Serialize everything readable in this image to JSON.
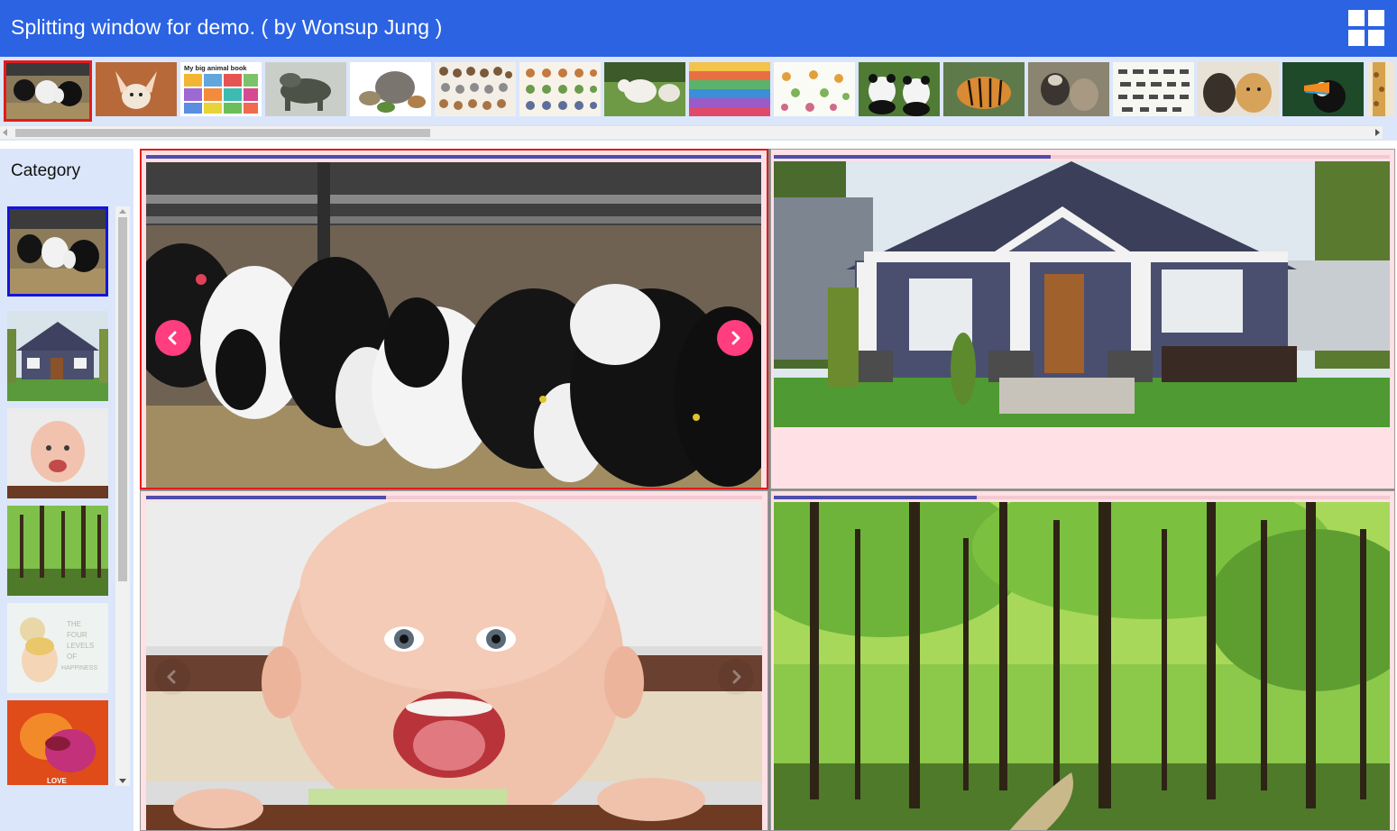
{
  "header": {
    "title": "Splitting window for demo. ( by Wonsup Jung )",
    "layout_icon": "grid-2x2-icon"
  },
  "thumbnail_strip": {
    "items": [
      {
        "name": "cows-thumb",
        "selected": true
      },
      {
        "name": "fennec-fox-thumb"
      },
      {
        "name": "animal-book-thumb",
        "caption": "My big animal book"
      },
      {
        "name": "komodo-dragon-thumb"
      },
      {
        "name": "wild-animals-group-thumb"
      },
      {
        "name": "animal-chart-thumb"
      },
      {
        "name": "animal-poster-thumb"
      },
      {
        "name": "lambs-thumb"
      },
      {
        "name": "colorful-animal-chart-thumb"
      },
      {
        "name": "animal-illustrations-thumb"
      },
      {
        "name": "pandas-thumb"
      },
      {
        "name": "tiger-thumb"
      },
      {
        "name": "sloth-thumb"
      },
      {
        "name": "animal-silhouettes-thumb"
      },
      {
        "name": "dog-and-cow-thumb"
      },
      {
        "name": "toucan-thumb"
      },
      {
        "name": "giraffe-partial-thumb"
      }
    ]
  },
  "sidebar": {
    "title": "Category",
    "items": [
      {
        "name": "cows",
        "selected": true
      },
      {
        "name": "house"
      },
      {
        "name": "baby"
      },
      {
        "name": "forest"
      },
      {
        "name": "happiness",
        "caption": "THE FOUR LEVELS OF HAPPINESS"
      },
      {
        "name": "love",
        "caption": "LOVE"
      }
    ]
  },
  "panels": [
    {
      "name": "cows",
      "active": true,
      "progress": 1.0,
      "prev_icon": "chevron-left-icon",
      "next_icon": "chevron-right-icon"
    },
    {
      "name": "house",
      "progress": 0.45
    },
    {
      "name": "baby",
      "progress": 0.39
    },
    {
      "name": "forest",
      "progress": 0.33
    }
  ],
  "colors": {
    "header": "#2b63e3",
    "strip_bg": "#dbe6fb",
    "active_border": "#e31b1b",
    "sidebar_selected_border": "#1414d8",
    "nav_button": "#ff3d7f",
    "progress_fill": "#4d4dab",
    "panel_bg": "#ffe0e5"
  }
}
